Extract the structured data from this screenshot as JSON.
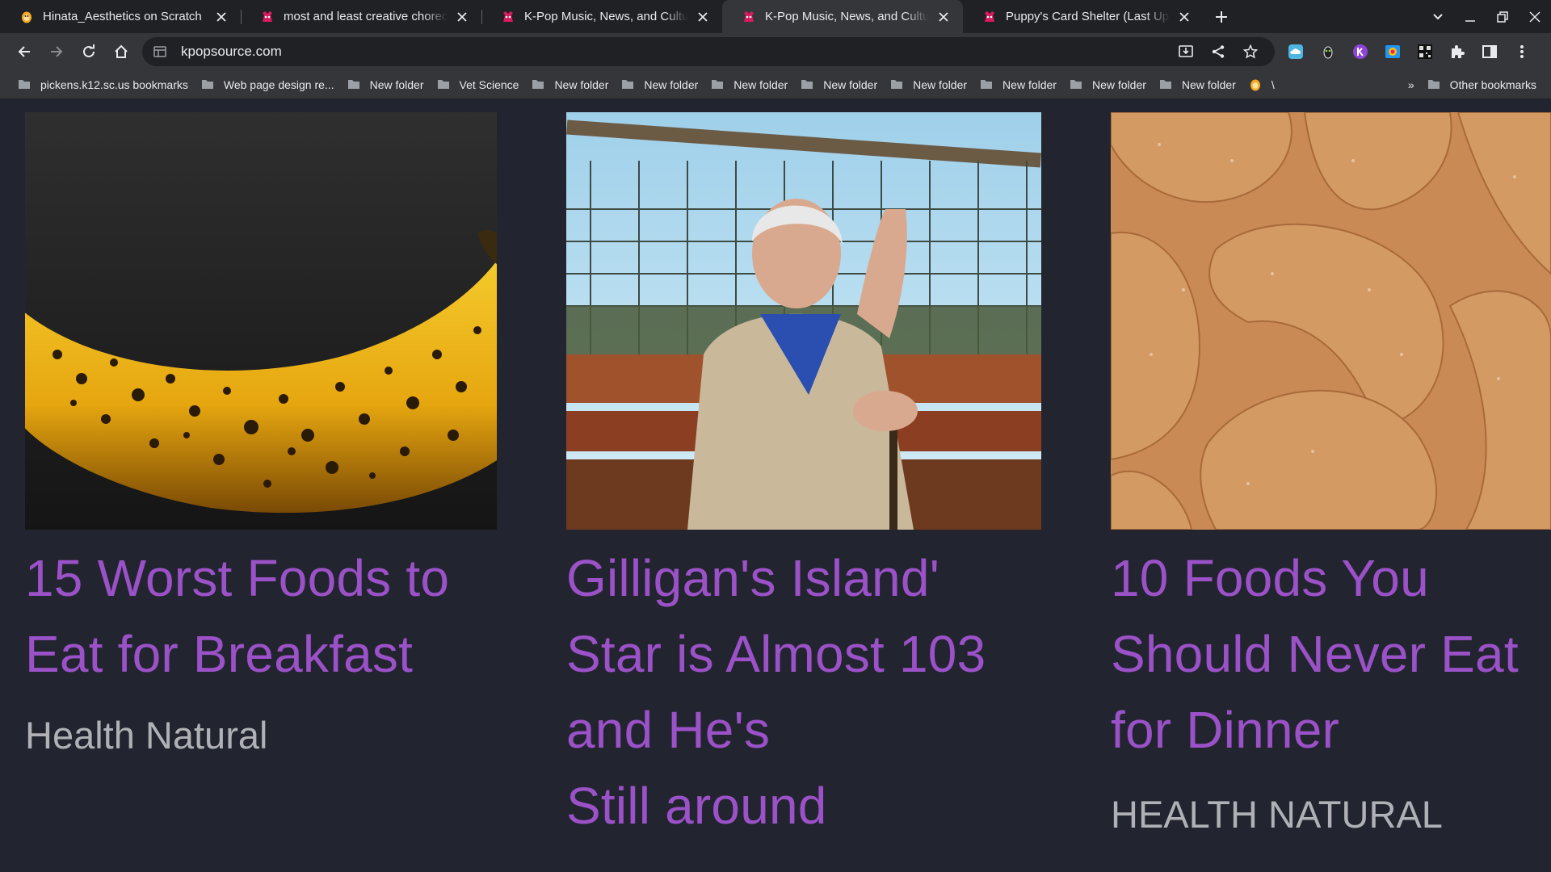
{
  "browser": {
    "tabs": [
      {
        "title": "Hinata_Aesthetics on Scratch",
        "favicon": "scratch-cat-icon",
        "active": false
      },
      {
        "title": "most and least creative choreo? -",
        "favicon": "kpopsource-icon",
        "active": false
      },
      {
        "title": "K-Pop Music, News, and Culture -",
        "favicon": "kpopsource-icon",
        "active": false
      },
      {
        "title": "K-Pop Music, News, and Culture -",
        "favicon": "kpopsource-icon",
        "active": true
      },
      {
        "title": "Puppy's Card Shelter (Last Updat",
        "favicon": "kpopsource-icon",
        "active": false
      }
    ],
    "url": "kpopsource.com",
    "bookmarks": [
      "pickens.k12.sc.us bookmarks",
      "Web page design re...",
      "New folder",
      "Vet Science",
      "New folder",
      "New folder",
      "New folder",
      "New folder",
      "New folder",
      "New folder",
      "New folder",
      "New folder",
      "\\"
    ],
    "overflow_label": "»",
    "other_bookmarks": "Other bookmarks"
  },
  "colors": {
    "tabstrip": "#202124",
    "toolbar": "#35363a",
    "page_bg": "#22252f",
    "headline": "#9b51c7",
    "source": "#b0b1b6"
  },
  "articles": [
    {
      "image": "overripe-banana-photo",
      "headline_lines": [
        "15 Worst Foods to",
        "Eat for Breakfast"
      ],
      "source": "Health Natural"
    },
    {
      "image": "elderly-man-on-bench-photo",
      "headline_lines": [
        "Gilligan's Island'",
        "Star is Almost 103",
        "and He's",
        "Still around"
      ],
      "source": ""
    },
    {
      "image": "cashew-nuts-photo",
      "headline_lines": [
        "10 Foods You",
        "Should Never Eat",
        "for Dinner"
      ],
      "source": "HEALTH NATURAL"
    }
  ]
}
